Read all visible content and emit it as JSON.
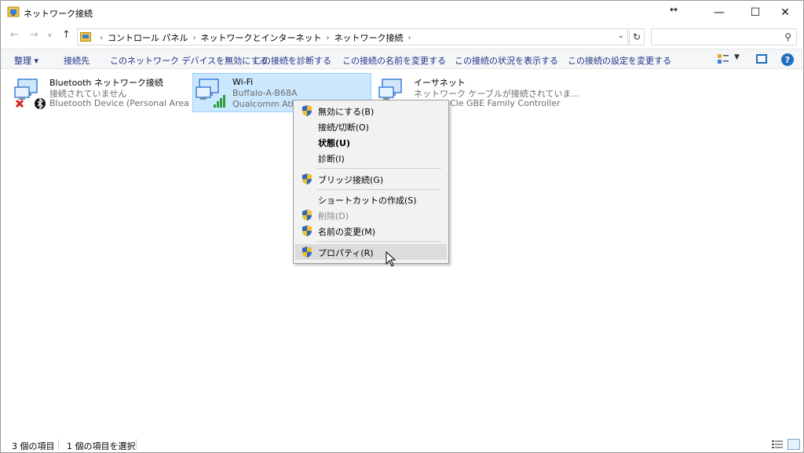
{
  "window": {
    "title": "ネットワーク接続",
    "resize_glyph": "↔",
    "controls": {
      "minimize": "—",
      "maximize": "☐",
      "close": "✕"
    }
  },
  "address": {
    "breadcrumbs": [
      "コントロール パネル",
      "ネットワークとインターネット",
      "ネットワーク接続"
    ],
    "search_placeholder": ""
  },
  "toolbar": {
    "organize": "整理 ▾",
    "commands": [
      "接続先",
      "このネットワーク デバイスを無効にする",
      "この接続を診断する",
      "この接続の名前を変更する",
      "この接続の状況を表示する",
      "この接続の設定を変更する"
    ],
    "help": "?"
  },
  "items": [
    {
      "name": "Bluetooth ネットワーク接続",
      "status": "接続されていません",
      "device": "Bluetooth Device (Personal Area ..."
    },
    {
      "name": "Wi-Fi",
      "status": "Buffalo-A-B68A",
      "device": "Qualcomm Athe"
    },
    {
      "name": "イーサネット",
      "status": "ネットワーク ケーブルが接続されていま...",
      "device": "Cle GBE Family Controller"
    }
  ],
  "context_menu": {
    "items": [
      {
        "label": "無効にする(B)",
        "shield": true,
        "bold": false,
        "disabled": false
      },
      {
        "label": "接続/切断(O)",
        "shield": false,
        "bold": false,
        "disabled": false
      },
      {
        "label": "状態(U)",
        "shield": false,
        "bold": true,
        "disabled": false
      },
      {
        "label": "診断(I)",
        "shield": false,
        "bold": false,
        "disabled": false
      },
      {
        "label": "ブリッジ接続(G)",
        "shield": true,
        "bold": false,
        "disabled": false
      },
      {
        "label": "ショートカットの作成(S)",
        "shield": false,
        "bold": false,
        "disabled": false
      },
      {
        "label": "削除(D)",
        "shield": true,
        "bold": false,
        "disabled": true
      },
      {
        "label": "名前の変更(M)",
        "shield": true,
        "bold": false,
        "disabled": false
      },
      {
        "label": "プロパティ(R)",
        "shield": true,
        "bold": false,
        "disabled": false,
        "hover": true
      }
    ]
  },
  "status_bar": {
    "item_count": "3 個の項目",
    "selected_count": "1 個の項目を選択"
  },
  "colors": {
    "selection_bg": "#cce8ff",
    "selection_border": "#99d1ff",
    "command_text": "#1e3287",
    "menu_bg": "#f2f2f2",
    "help_blue": "#1f6fbf"
  }
}
